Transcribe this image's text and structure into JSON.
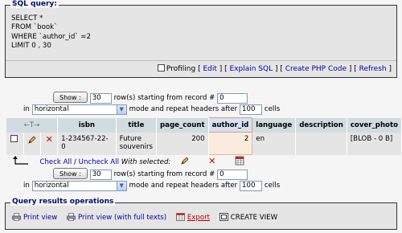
{
  "sql_query": {
    "legend": "SQL query:",
    "lines": [
      "SELECT *",
      "FROM `book`",
      "WHERE `author_id` =2",
      "LIMIT 0 , 30"
    ],
    "links": {
      "profiling": "Profiling",
      "edit": "Edit",
      "explain": "Explain SQL",
      "create_php": "Create PHP Code",
      "refresh": "Refresh"
    }
  },
  "nav": {
    "show_button": "Show :",
    "row_count": "30",
    "rows_starting_text": "row(s) starting from record #",
    "start_record": "0",
    "in_label": "in",
    "mode": "horizontal",
    "mode_text": "mode and repeat headers after",
    "repeat_headers": "100",
    "cells_text": "cells"
  },
  "table": {
    "sort_arrows": "←T→",
    "columns": [
      "isbn",
      "title",
      "page_count",
      "author_id",
      "language",
      "description",
      "cover_photo"
    ],
    "rows": [
      {
        "isbn": "1-234567-22-0",
        "title_line1": "Future",
        "title_line2": "souvenirs",
        "page_count": "200",
        "author_id": "2",
        "language": "en",
        "description": "",
        "cover_photo": "[BLOB - 0 B]"
      }
    ]
  },
  "bulk": {
    "check_all": "Check All",
    "separator": "/",
    "uncheck_all": "Uncheck All",
    "with_selected": "With selected:"
  },
  "operations": {
    "legend": "Query results operations",
    "print_view": "Print view",
    "print_view_full": "Print view (with full texts)",
    "export": "Export",
    "create_view": "CREATE VIEW"
  },
  "colors": {
    "legend_blue": "#00126b",
    "link_blue": "#0000aa",
    "header_bg": "#d0dce0",
    "delete_red": "#cc0000"
  }
}
